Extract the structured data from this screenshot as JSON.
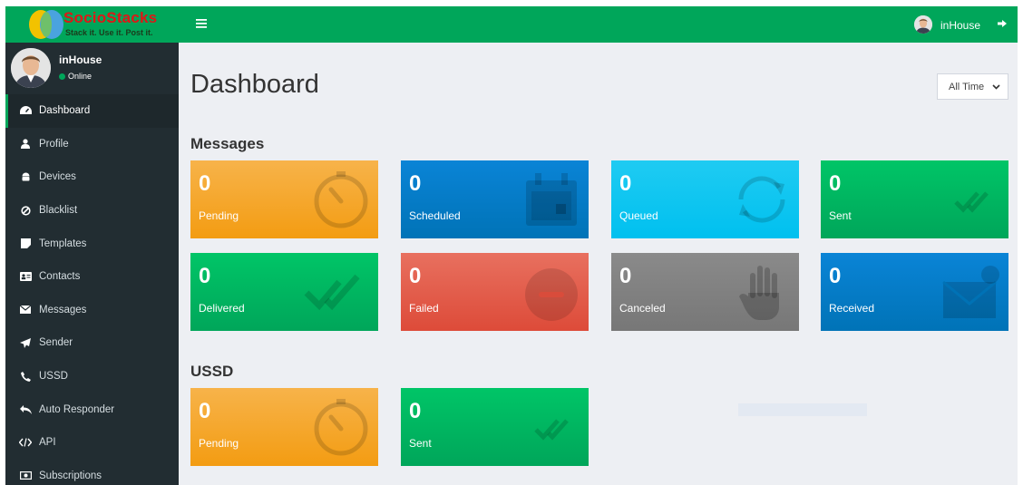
{
  "brand": {
    "name": "SocioStacks",
    "tagline": "Stack it. Use it. Post it."
  },
  "user": {
    "name": "inHouse",
    "status": "Online"
  },
  "sidebar": {
    "items": [
      {
        "label": "Dashboard",
        "icon": "dashboard-icon"
      },
      {
        "label": "Profile",
        "icon": "user-icon"
      },
      {
        "label": "Devices",
        "icon": "android-icon"
      },
      {
        "label": "Blacklist",
        "icon": "ban-icon"
      },
      {
        "label": "Templates",
        "icon": "sticky-note-icon"
      },
      {
        "label": "Contacts",
        "icon": "address-card-icon"
      },
      {
        "label": "Messages",
        "icon": "envelope-icon"
      },
      {
        "label": "Sender",
        "icon": "paper-plane-icon"
      },
      {
        "label": "USSD",
        "icon": "phone-icon"
      },
      {
        "label": "Auto Responder",
        "icon": "reply-all-icon"
      },
      {
        "label": "API",
        "icon": "code-icon"
      },
      {
        "label": "Subscriptions",
        "icon": "money-icon"
      }
    ]
  },
  "topbar": {
    "user_name": "inHouse"
  },
  "main": {
    "title": "Dashboard",
    "range": "All Time",
    "messages_title": "Messages",
    "ussd_title": "USSD",
    "messages": [
      {
        "value": "0",
        "label": "Pending",
        "color": "#f39c12",
        "icon": "stopwatch-icon"
      },
      {
        "value": "0",
        "label": "Scheduled",
        "color": "#0073b7",
        "icon": "calendar-icon"
      },
      {
        "value": "0",
        "label": "Queued",
        "color": "#00c0ef",
        "icon": "sync-icon"
      },
      {
        "value": "0",
        "label": "Sent",
        "color": "#00a65a",
        "icon": "check-icon"
      },
      {
        "value": "0",
        "label": "Delivered",
        "color": "#00a65a",
        "icon": "double-check-icon"
      },
      {
        "value": "0",
        "label": "Failed",
        "color": "#dd4b39",
        "icon": "minus-circle-icon"
      },
      {
        "value": "0",
        "label": "Canceled",
        "color": "#777777",
        "icon": "hand-stop-icon"
      },
      {
        "value": "0",
        "label": "Received",
        "color": "#0073b7",
        "icon": "envelope-open-icon"
      }
    ],
    "ussd": [
      {
        "value": "0",
        "label": "Pending",
        "color": "#f39c12",
        "icon": "stopwatch-icon"
      },
      {
        "value": "0",
        "label": "Sent",
        "color": "#00a65a",
        "icon": "check-icon"
      }
    ]
  }
}
